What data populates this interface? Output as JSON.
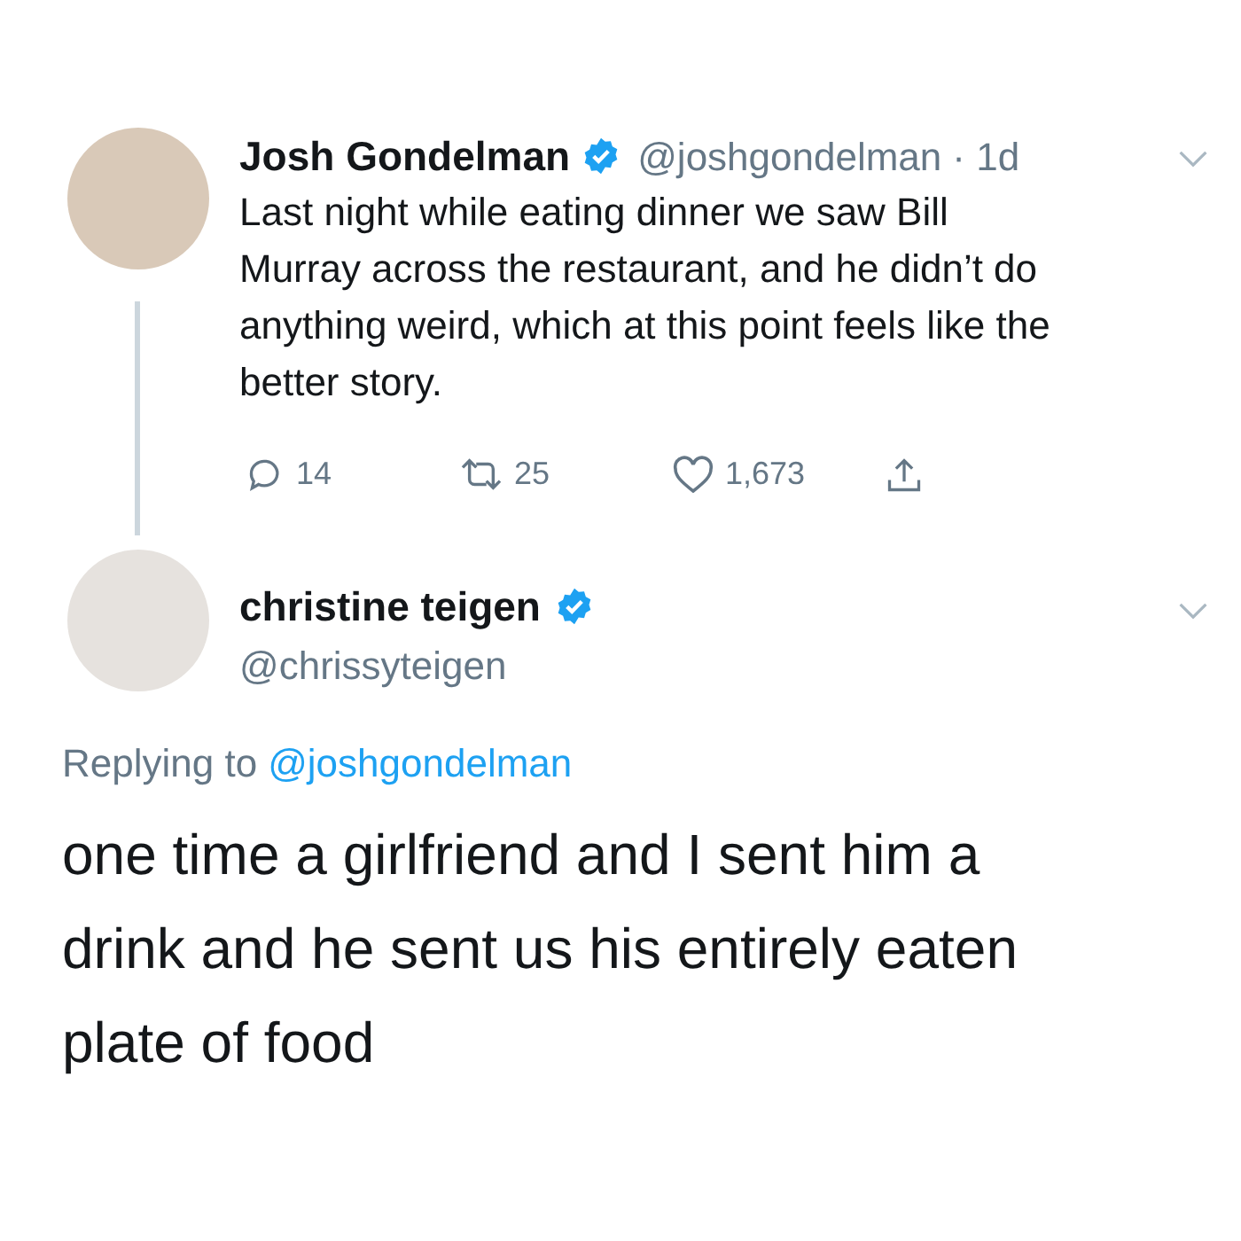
{
  "tweet": {
    "name": "Josh Gondelman",
    "verified": true,
    "handle": "@joshgondelman",
    "time": "· 1d",
    "text": "Last night while eating dinner we saw Bill Murray across the restaurant, and he didn’t do anything weird, which at this point feels like the better story.",
    "actions": [
      {
        "kind": "reply",
        "count": "14"
      },
      {
        "kind": "retweet",
        "count": "25"
      },
      {
        "kind": "like",
        "count": "1,673"
      },
      {
        "kind": "share"
      }
    ]
  },
  "reply": {
    "name": "christine teigen",
    "verified": true,
    "handle": "@chrissyteigen",
    "replying_label": "Replying to",
    "replying_to": "@joshgondelman",
    "text": "one time a girlfriend and I sent him a drink and he sent us his entirely eaten plate of food"
  }
}
